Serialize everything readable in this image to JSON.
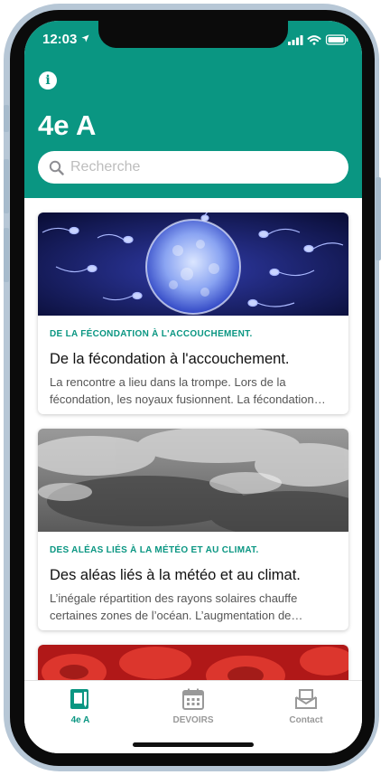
{
  "status_bar": {
    "time": "12:03"
  },
  "header": {
    "title": "4e A"
  },
  "search": {
    "placeholder": "Recherche",
    "value": ""
  },
  "cards": [
    {
      "kicker": "DE LA FÉCONDATION À L'ACCOUCHEMENT.",
      "title": "De la fécondation à l'accouchement.",
      "excerpt": "La rencontre a lieu dans la trompe. Lors de la fécondation, les noyaux fusionnent. La fécondation…"
    },
    {
      "kicker": "DES ALÉAS LIÉS À LA MÉTÉO ET AU CLIMAT.",
      "title": "Des aléas liés à la météo et au climat.",
      "excerpt": "L’inégale répartition des rayons solaires chauffe certaines zones de l’océan. L’augmentation de…"
    }
  ],
  "tabbar": {
    "tabs": [
      {
        "label": "4e A",
        "icon": "notebook-icon",
        "active": true
      },
      {
        "label": "DEVOIRS",
        "icon": "calendar-icon",
        "active": false
      },
      {
        "label": "Contact",
        "icon": "mail-icon",
        "active": false
      }
    ]
  },
  "colors": {
    "accent": "#0a9682",
    "inactive": "#999999",
    "background": "#ffffff"
  }
}
